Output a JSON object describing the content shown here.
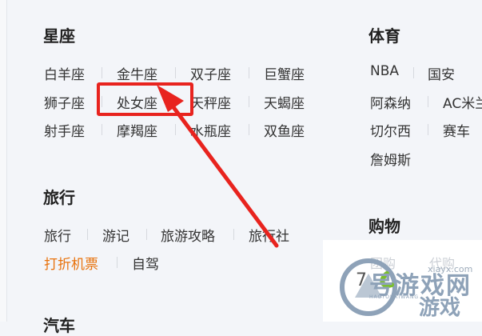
{
  "constellation": {
    "title": "星座",
    "items": [
      "白羊座",
      "金牛座",
      "双子座",
      "巨蟹座",
      "狮子座",
      "处女座",
      "天秤座",
      "天蝎座",
      "射手座",
      "摩羯座",
      "水瓶座",
      "双鱼座"
    ]
  },
  "sports": {
    "title": "体育",
    "items": [
      "NBA",
      "国安",
      "阿森纳",
      "AC米兰",
      "切尔西",
      "赛车",
      "詹姆斯"
    ]
  },
  "travel": {
    "title": "旅行",
    "items": [
      "旅行",
      "游记",
      "旅游攻略",
      "旅行社",
      "打折机票",
      "自驾"
    ]
  },
  "shopping": {
    "title": "购物",
    "items": [
      "团购",
      "代购"
    ]
  },
  "partial_title": "汽车",
  "fragment_text": "7",
  "watermark": {
    "site_cn": "号游戏网",
    "url": "xiayx.com",
    "pinyin": "HAOYOUXIWANG",
    "slogan": "游戏"
  },
  "colors": {
    "highlight": "#e8231e",
    "link_orange": "#e8720c"
  }
}
